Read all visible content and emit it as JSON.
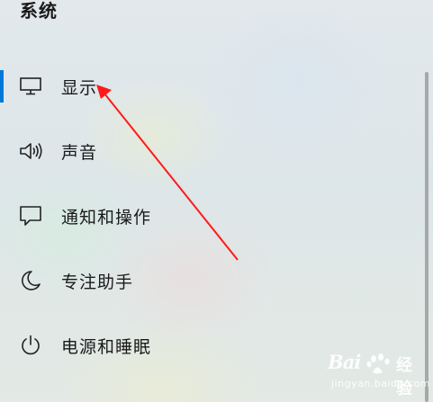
{
  "section": {
    "title": "系统"
  },
  "nav": {
    "items": [
      {
        "label": "显示",
        "icon": "monitor-icon",
        "selected": true
      },
      {
        "label": "声音",
        "icon": "speaker-icon",
        "selected": false
      },
      {
        "label": "通知和操作",
        "icon": "notification-icon",
        "selected": false
      },
      {
        "label": "专注助手",
        "icon": "moon-icon",
        "selected": false
      },
      {
        "label": "电源和睡眠",
        "icon": "power-icon",
        "selected": false
      }
    ]
  },
  "colors": {
    "accent": "#0078d7",
    "annotation_arrow": "#ff1a1a",
    "scrollbar": "#a6a9ab"
  },
  "watermark": {
    "brand": "Bai",
    "brand_suffix": "经验",
    "url": "jingyan.baidu.com"
  }
}
